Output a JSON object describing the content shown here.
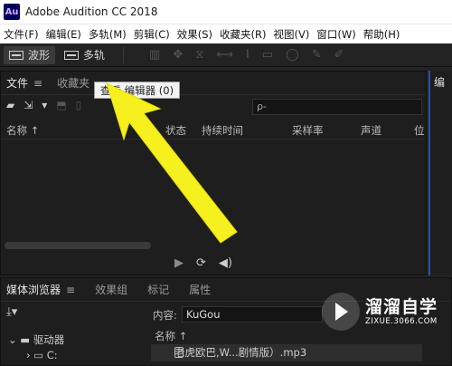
{
  "app": {
    "icon_text": "Au",
    "title": "Adobe Audition CC 2018"
  },
  "menu": [
    "文件(F)",
    "编辑(E)",
    "多轨(M)",
    "剪辑(C)",
    "效果(S)",
    "收藏夹(R)",
    "视图(V)",
    "窗口(W)",
    "帮助(H)"
  ],
  "toolbar": {
    "waveform_label": "波形",
    "multitrack_label": "多轨"
  },
  "files_panel": {
    "tab_files": "文件",
    "tab_favorites": "收藏夹",
    "search_placeholder": "ρ-",
    "columns": {
      "name": "名称 ↑",
      "status": "状态",
      "duration": "持续时间",
      "sample_rate": "采样率",
      "channels": "声道",
      "bits": "位"
    }
  },
  "tooltip": {
    "text": "查看                 编辑器 (0)"
  },
  "right_panel": {
    "label": "编"
  },
  "media_browser": {
    "tab_media": "媒体浏览器",
    "tab_effects": "效果组",
    "tab_markers": "标记",
    "tab_properties": "属性",
    "content_label": "内容:",
    "content_value": "KuGou",
    "drives_label": "驱动器",
    "drive_c": "C:",
    "name_column": "名称 ↑",
    "file_name": "老虎欧巴,W...剧情版）.mp3"
  },
  "watermark": {
    "brand": "溜溜自学",
    "url": "ZIXUE.3066.COM"
  },
  "colors": {
    "arrow": "#f5f01e",
    "accent": "#2d4fb0"
  }
}
